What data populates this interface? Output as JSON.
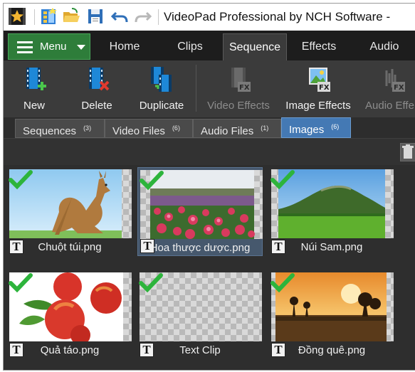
{
  "window": {
    "title": "VideoPad Professional by NCH Software - "
  },
  "quick_access": [
    {
      "icon": "app-star-icon"
    },
    {
      "icon": "new-project-icon"
    },
    {
      "icon": "open-folder-icon"
    },
    {
      "icon": "save-icon"
    },
    {
      "icon": "undo-icon"
    },
    {
      "icon": "redo-icon"
    }
  ],
  "menu": {
    "label": "Menu"
  },
  "tabs": [
    {
      "label": "Home"
    },
    {
      "label": "Clips"
    },
    {
      "label": "Sequence",
      "active": true
    },
    {
      "label": "Effects"
    },
    {
      "label": "Audio"
    }
  ],
  "ribbon": {
    "buttons": [
      {
        "label": "New",
        "icon": "new-sequence-icon",
        "enabled": true
      },
      {
        "label": "Delete",
        "icon": "delete-sequence-icon",
        "enabled": true
      },
      {
        "label": "Duplicate",
        "icon": "duplicate-sequence-icon",
        "enabled": true
      },
      {
        "label": "Video Effects",
        "icon": "video-effects-icon",
        "enabled": false
      },
      {
        "label": "Image Effects",
        "icon": "image-effects-icon",
        "enabled": true
      },
      {
        "label": "Audio Effe",
        "icon": "audio-effects-icon",
        "enabled": false
      }
    ]
  },
  "bin_tabs": [
    {
      "label": "Sequences",
      "count": "(3)"
    },
    {
      "label": "Video Files",
      "count": "(6)"
    },
    {
      "label": "Audio Files",
      "count": "(1)"
    },
    {
      "label": "Images",
      "count": "(6)",
      "active": true
    }
  ],
  "toolbar": {
    "trash_icon": "trash-icon"
  },
  "items": [
    {
      "name": "Chuột túi.png",
      "image": "kangaroo",
      "checked": true,
      "selected": false
    },
    {
      "name": "Hoa thược dược.png",
      "image": "flowers",
      "checked": true,
      "selected": true
    },
    {
      "name": "Núi Sam.png",
      "image": "mountain",
      "checked": true,
      "selected": false
    },
    {
      "name": "Quả táo.png",
      "image": "apples",
      "checked": true,
      "selected": false
    },
    {
      "name": "Text Clip",
      "image": "transparent",
      "checked": true,
      "selected": false
    },
    {
      "name": "Đồng quê.png",
      "image": "sunset",
      "checked": true,
      "selected": false
    }
  ],
  "colors": {
    "accent": "#4479b4",
    "menu": "#2e7d3a",
    "check": "#2db43c"
  }
}
